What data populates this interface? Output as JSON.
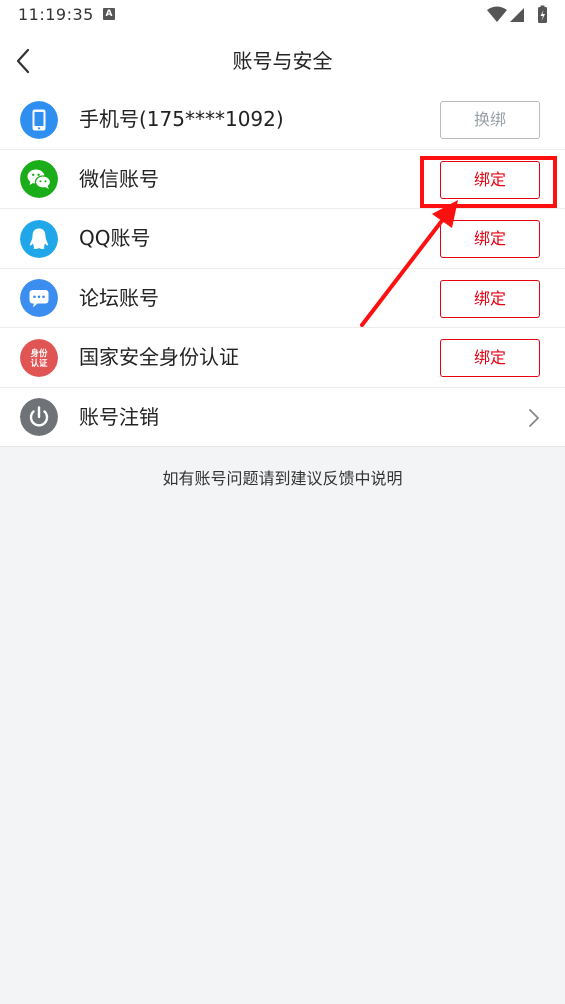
{
  "status_bar": {
    "time": "11:19:35",
    "notification_badge": "A"
  },
  "header": {
    "title": "账号与安全"
  },
  "accounts": [
    {
      "label": "手机号(175****1092)",
      "icon": "phone-icon",
      "icon_color": "#2f8ff0",
      "action": "换绑",
      "action_style": "grey"
    },
    {
      "label": "微信账号",
      "icon": "wechat-icon",
      "icon_color": "#1aad19",
      "action": "绑定",
      "action_style": "red"
    },
    {
      "label": "QQ账号",
      "icon": "qq-icon",
      "icon_color": "#20a7ea",
      "action": "绑定",
      "action_style": "red"
    },
    {
      "label": "论坛账号",
      "icon": "forum-icon",
      "icon_color": "#3c8df0",
      "action": "绑定",
      "action_style": "red"
    },
    {
      "label": "国家安全身份认证",
      "icon": "identity-icon",
      "icon_color": "#e05454",
      "icon_text": [
        "身份",
        "认证"
      ],
      "action": "绑定",
      "action_style": "red"
    },
    {
      "label": "账号注销",
      "icon": "power-icon",
      "icon_color": "#6f7378"
    }
  ],
  "footer_note": "如有账号问题请到建议反馈中说明",
  "colors": {
    "accent_red": "#e60012",
    "annotation_red": "#ff1010",
    "page_background": "#f3f4f6"
  }
}
